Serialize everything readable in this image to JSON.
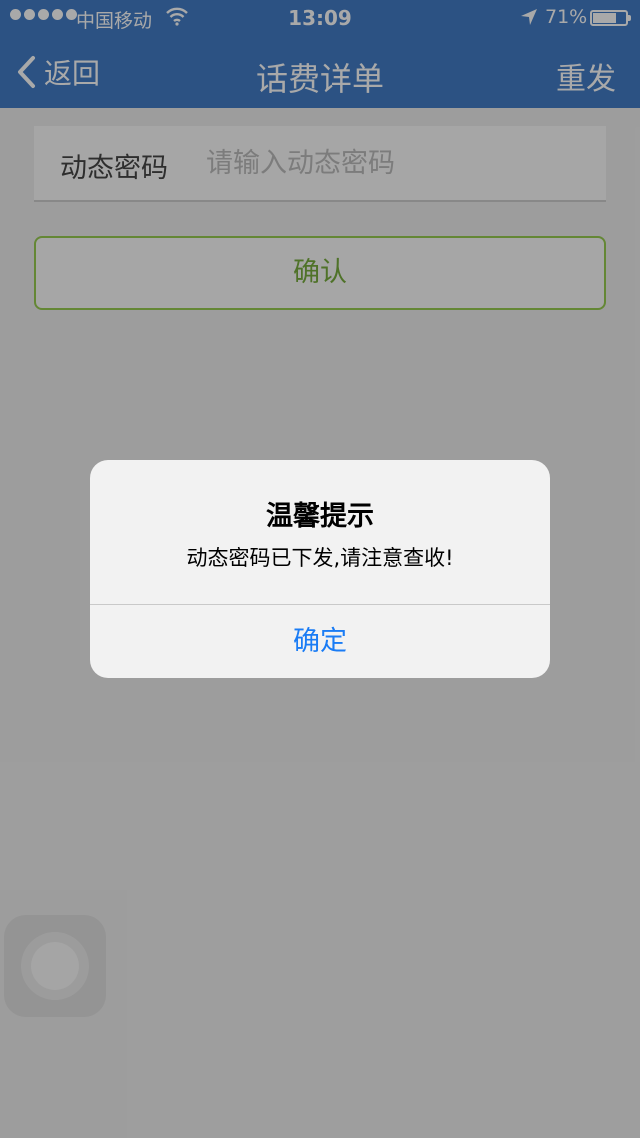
{
  "status_bar": {
    "carrier": "中国移动",
    "time": "13:09",
    "battery_percent": "71%",
    "signal_bars": 5,
    "battery_level": 0.71
  },
  "nav": {
    "back_label": "返回",
    "title": "话费详单",
    "right_label": "重发"
  },
  "form": {
    "field_label": "动态密码",
    "field_placeholder": "请输入动态密码",
    "field_value": "",
    "confirm_label": "确认"
  },
  "alert": {
    "title": "温馨提示",
    "message": "动态密码已下发,请注意查收!",
    "button_label": "确定"
  },
  "colors": {
    "nav_bar": "#2f6fc0",
    "confirm_border": "#8cc63f",
    "alert_button": "#1a7cf5"
  }
}
